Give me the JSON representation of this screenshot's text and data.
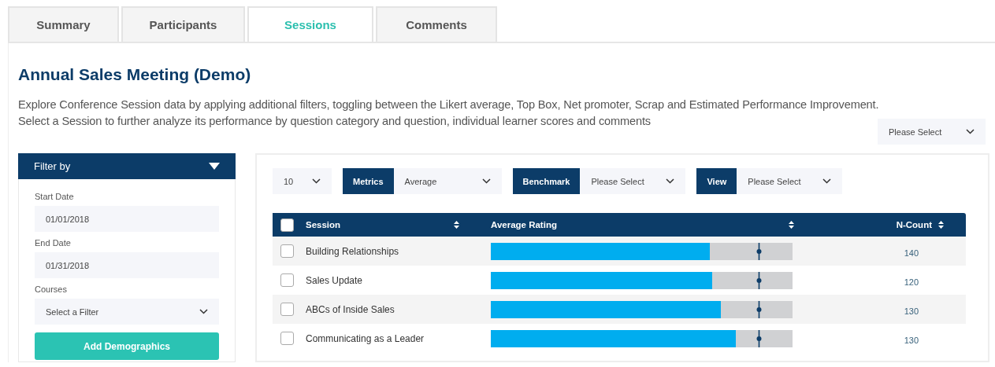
{
  "tabs": [
    {
      "label": "Summary",
      "selected": false
    },
    {
      "label": "Participants",
      "selected": false
    },
    {
      "label": "Sessions",
      "selected": true
    },
    {
      "label": "Comments",
      "selected": false
    }
  ],
  "title": "Annual Sales Meeting (Demo)",
  "description": [
    "Explore Conference Session data by applying additional filters, toggling between the Likert average, Top Box, Net promoter, Scrap and Estimated Performance Improvement.",
    "Select a Session to further analyze its performance by question category and question, individual learner scores and comments"
  ],
  "top_select": {
    "value": "Please Select"
  },
  "filter": {
    "title": "Filter by",
    "expanded": true,
    "fields": [
      {
        "label": "Start Date",
        "value": "01/01/2018",
        "kind": "input"
      },
      {
        "label": "End Date",
        "value": "01/31/2018",
        "kind": "input"
      },
      {
        "label": "Courses",
        "value": "Select a Filter",
        "kind": "select"
      }
    ],
    "button": "Add Demographics"
  },
  "controls": {
    "page_size": "10",
    "selects": [
      {
        "label": "Metrics",
        "value": "Average"
      },
      {
        "label": "Benchmark",
        "value": "Please Select"
      },
      {
        "label": "View",
        "value": "Please Select"
      }
    ]
  },
  "table": {
    "all_checked": false,
    "columns": [
      "Session",
      "Average Rating",
      "N-Count"
    ],
    "rows": [
      {
        "checked": false,
        "session": "Building Relationships",
        "level": 0.726,
        "marker": {
          "level": 0.888
        },
        "count": "140"
      },
      {
        "checked": false,
        "session": "Sales Update",
        "level": 0.734,
        "marker": {
          "level": 0.888
        },
        "count": "120"
      },
      {
        "checked": false,
        "session": "ABCs of Inside Sales",
        "level": 0.762,
        "marker": {
          "level": 0.888
        },
        "count": "130"
      },
      {
        "checked": false,
        "session": "Communicating as a Leader",
        "level": 0.812,
        "marker": {
          "level": 0.888
        },
        "count": "130"
      }
    ]
  }
}
